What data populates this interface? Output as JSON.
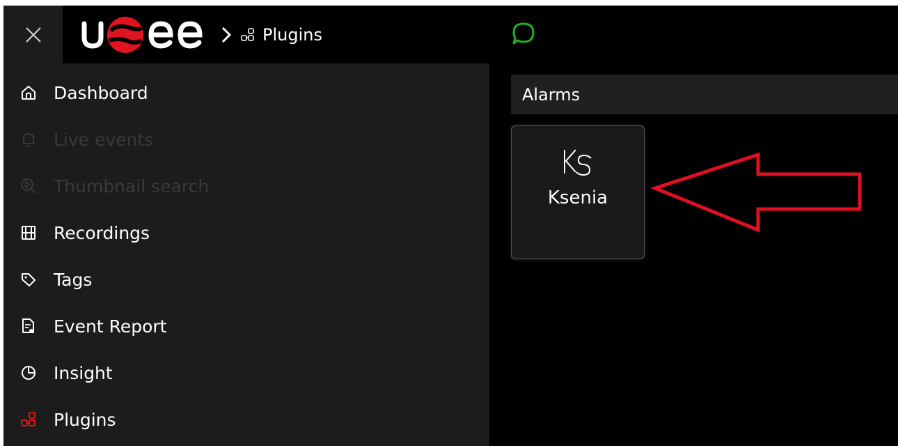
{
  "header": {
    "logo_text": "usee",
    "breadcrumb_label": "Plugins"
  },
  "sidebar": {
    "items": [
      {
        "label": "Dashboard",
        "icon": "home-icon",
        "enabled": true
      },
      {
        "label": "Live events",
        "icon": "bell-icon",
        "enabled": false
      },
      {
        "label": "Thumbnail search",
        "icon": "play-search-icon",
        "enabled": false
      },
      {
        "label": "Recordings",
        "icon": "film-icon",
        "enabled": true
      },
      {
        "label": "Tags",
        "icon": "tag-icon",
        "enabled": true
      },
      {
        "label": "Event Report",
        "icon": "report-icon",
        "enabled": true
      },
      {
        "label": "Insight",
        "icon": "pie-chart-icon",
        "enabled": true
      },
      {
        "label": "Plugins",
        "icon": "plugins-icon",
        "enabled": true,
        "active": true
      }
    ]
  },
  "main": {
    "section_title": "Alarms",
    "plugins": [
      {
        "label": "Ksenia",
        "logo_text": "KS"
      }
    ]
  },
  "colors": {
    "background": "#000000",
    "sidebar": "#1c1c1c",
    "brand_red": "#e0141e",
    "chat_green": "#1db31d",
    "annotation_red": "#e01020",
    "disabled_text": "#3a3a3a"
  }
}
